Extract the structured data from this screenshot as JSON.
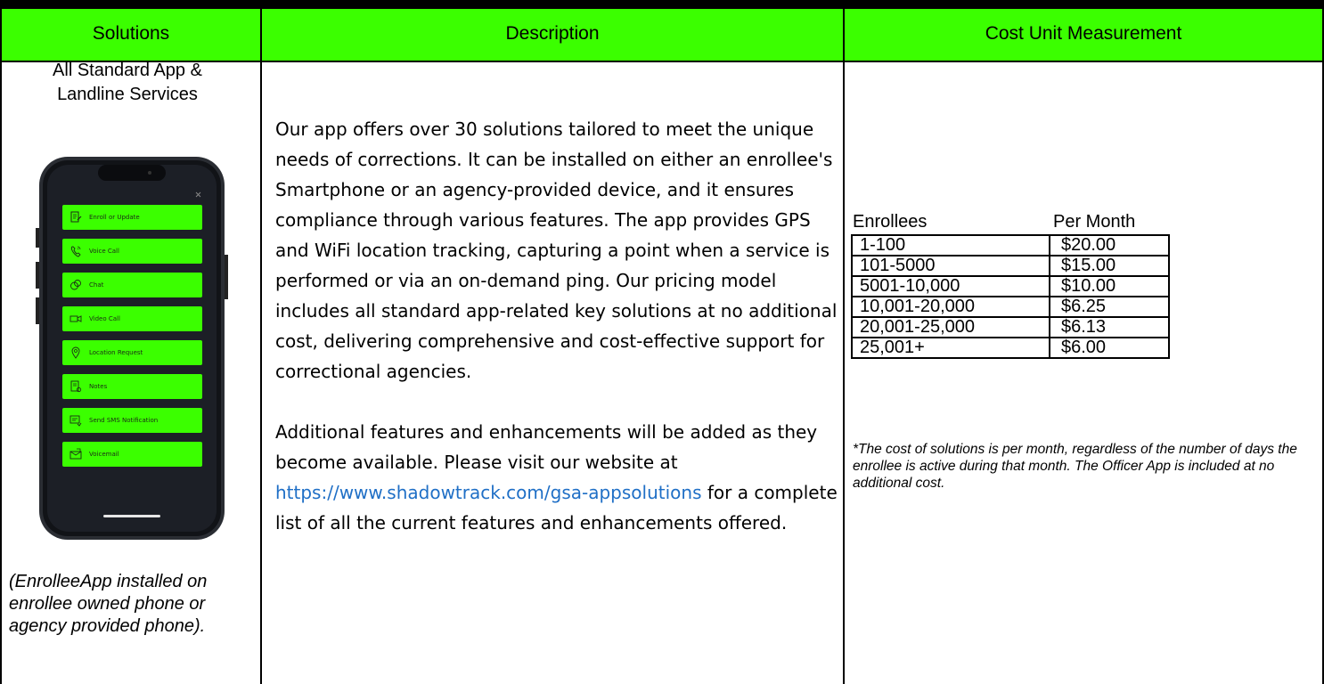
{
  "header": {
    "solutions": "Solutions",
    "description": "Description",
    "cost": "Cost Unit Measurement"
  },
  "solutions": {
    "title_line1": "All Standard App &",
    "title_line2": "Landline Services",
    "note": "(EnrolleeApp installed on enrollee owned phone or agency provided phone)."
  },
  "phone_menu": [
    {
      "label": "Enroll or Update",
      "icon": "enroll-icon"
    },
    {
      "label": "Voice Call",
      "icon": "phone-icon"
    },
    {
      "label": "Chat",
      "icon": "chat-icon"
    },
    {
      "label": "Video Call",
      "icon": "video-icon"
    },
    {
      "label": "Location Request",
      "icon": "location-icon"
    },
    {
      "label": "Notes",
      "icon": "notes-icon"
    },
    {
      "label": "Send SMS Notification",
      "icon": "sms-icon"
    },
    {
      "label": "Voicemail",
      "icon": "voicemail-icon"
    }
  ],
  "description": {
    "para1": "Our app offers over 30 solutions tailored to meet the unique needs of corrections. It can be installed on either an enrollee's Smartphone or an agency-provided device, and it ensures compliance through various features. The app provides GPS and WiFi location tracking, capturing a point when a service is performed or via an on-demand ping. Our pricing model includes all standard app-related key solutions at no additional cost, delivering comprehensive and cost-effective support for correctional agencies.",
    "para2_before": "Additional features and enhancements will be added as they become available. Please visit our website at ",
    "link": "https://www.shadowtrack.com/gsa-appsolutions",
    "para2_after": " for a complete list of all the current features and enhancements offered."
  },
  "cost": {
    "col1": "Enrollees",
    "col2": "Per Month",
    "rows": [
      {
        "range": " 1-100",
        "price": "$20.00"
      },
      {
        "range": "101-5000",
        "price": "$15.00"
      },
      {
        "range": "5001-10,000",
        "price": "$10.00"
      },
      {
        "range": "10,001-20,000",
        "price": "$6.25"
      },
      {
        "range": "20,001-25,000",
        "price": "$6.13"
      },
      {
        "range": "25,001+",
        "price": "$6.00"
      }
    ],
    "footnote": "*The cost of solutions is per month, regardless of the number of days the enrollee is active during that month. The Officer App is included at no additional cost."
  },
  "colors": {
    "header_bg": "#3bff00",
    "link": "#1f6fc6",
    "phone_screen": "#1c1f26"
  }
}
